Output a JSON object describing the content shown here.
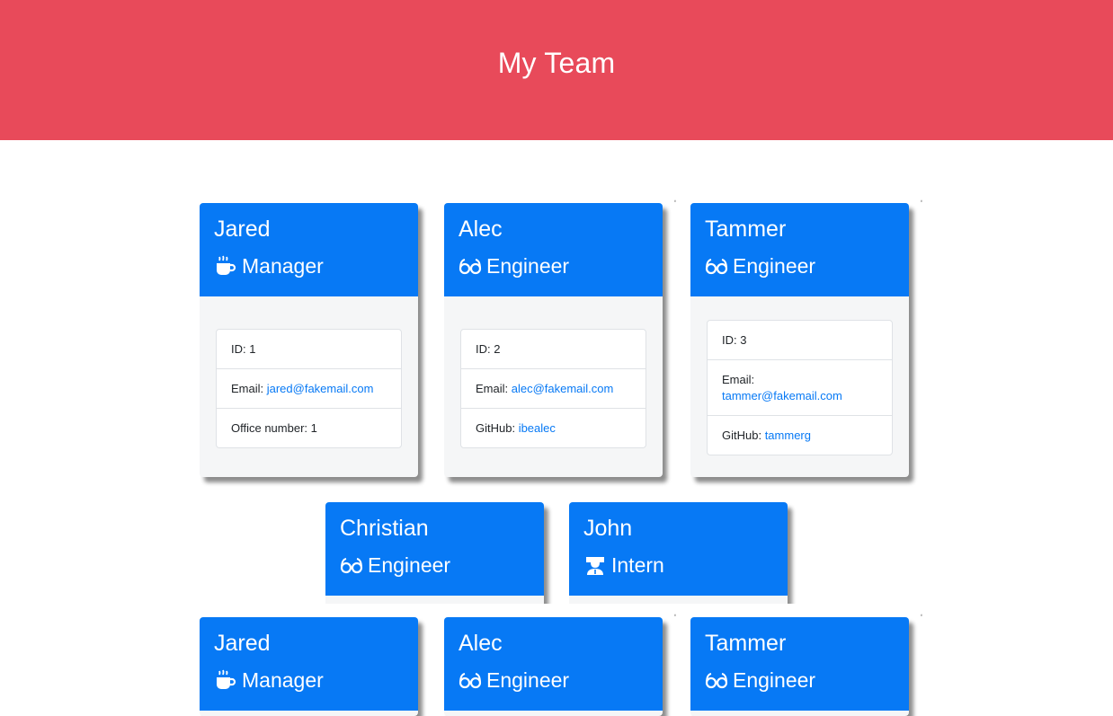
{
  "header": {
    "title": "My Team"
  },
  "labels": {
    "id": "ID: ",
    "email": "Email: ",
    "office": "Office number: ",
    "github": "GitHub: "
  },
  "cards": [
    {
      "name": "Jared",
      "role": "Manager",
      "icon": "coffee-icon",
      "id": "1",
      "email": "jared@fakemail.com",
      "office": "1"
    },
    {
      "name": "Alec",
      "role": "Engineer",
      "icon": "glasses-icon",
      "id": "2",
      "email": "alec@fakemail.com",
      "github": "ibealec"
    },
    {
      "name": "Tammer",
      "role": "Engineer",
      "icon": "glasses-icon",
      "id": "3",
      "email": "tammer@fakemail.com",
      "github": "tammerg"
    },
    {
      "name": "Christian",
      "role": "Engineer",
      "icon": "glasses-icon"
    },
    {
      "name": "John",
      "role": "Intern",
      "icon": "graduate-icon"
    },
    {
      "name": "Jared",
      "role": "Manager",
      "icon": "coffee-icon"
    },
    {
      "name": "Alec",
      "role": "Engineer",
      "icon": "glasses-icon"
    },
    {
      "name": "Tammer",
      "role": "Engineer",
      "icon": "glasses-icon"
    }
  ],
  "colors": {
    "header": "#e84a5a",
    "card_head": "#0779f5",
    "link": "#0779f5"
  }
}
